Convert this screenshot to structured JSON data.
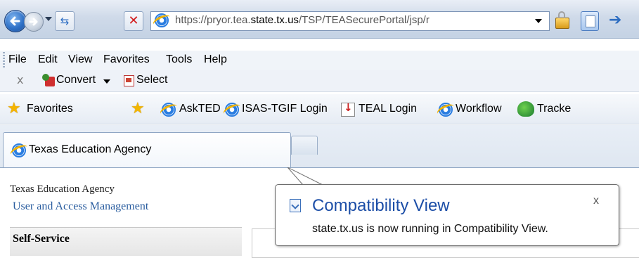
{
  "browser": {
    "address_url_prefix": "https://pryor.tea.",
    "address_url_domain": "state.tx.us",
    "address_url_suffix": "/TSP/TEASecurePortal/jsp/r"
  },
  "menu": {
    "items": [
      "File",
      "Edit",
      "View",
      "Favorites",
      "Tools",
      "Help"
    ]
  },
  "converter_bar": {
    "close_label": "x",
    "convert_label": "Convert",
    "select_label": "Select"
  },
  "favorites_bar": {
    "favorites_label": "Favorites",
    "links": [
      "AskTED",
      "ISAS-TGIF Login",
      "TEAL Login",
      "Workflow",
      "Tracke"
    ]
  },
  "tab": {
    "title": "Texas Education Agency"
  },
  "page": {
    "org_name": "Texas Education Agency",
    "subtitle": "User and Access Management",
    "panel_title": "Self-Service"
  },
  "notification": {
    "title": "Compatibility View",
    "message": "state.tx.us is now running in Compatibility View.",
    "close_label": "x"
  },
  "colors": {
    "toolbar_bg": "#cfdae9",
    "link_blue": "#2a5d9f",
    "balloon_title": "#1c4ea7"
  }
}
